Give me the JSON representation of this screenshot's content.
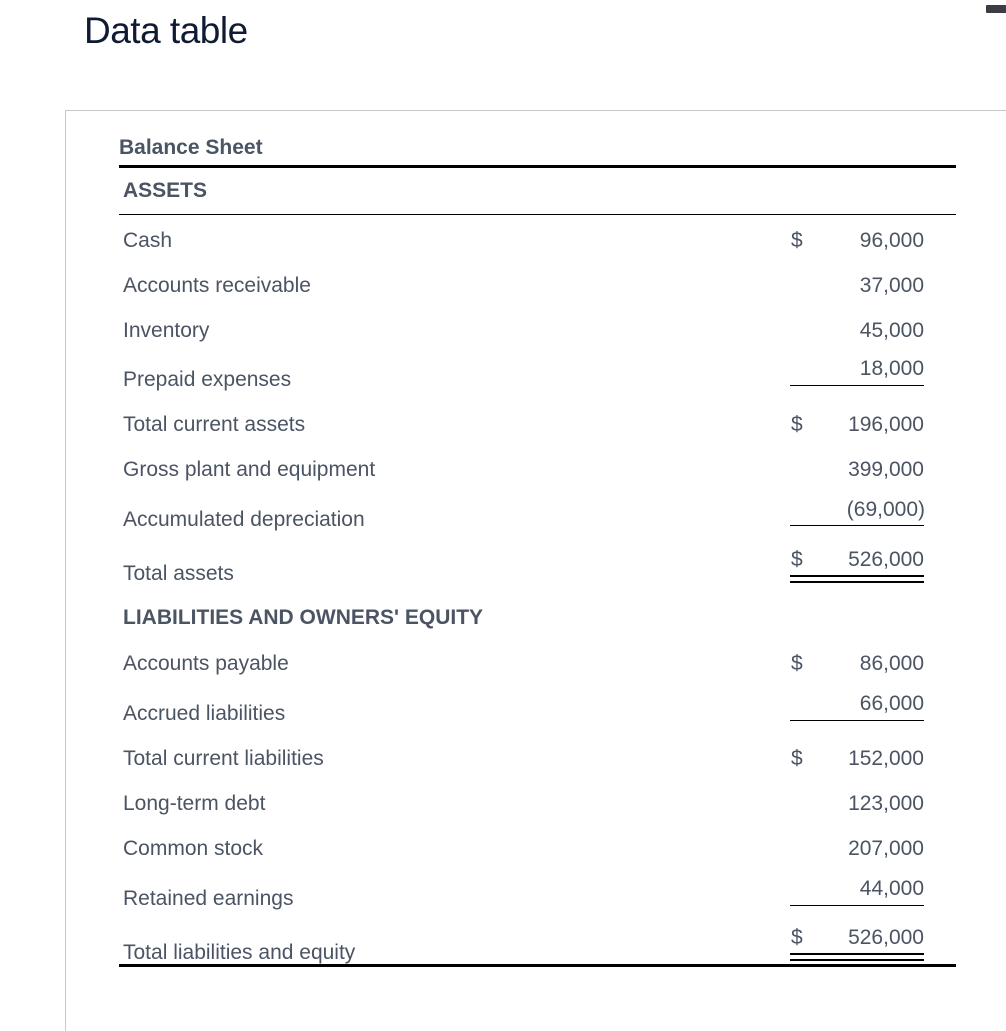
{
  "page_title": "Data table",
  "sheet": {
    "title": "Balance Sheet",
    "assets_heading": "ASSETS",
    "liabilities_heading": "LIABILITIES AND OWNERS' EQUITY",
    "currency_symbol": "$",
    "assets": [
      {
        "label": "Cash",
        "amount": "96,000",
        "dollar": "$"
      },
      {
        "label": "Accounts receivable",
        "amount": "37,000",
        "dollar": ""
      },
      {
        "label": "Inventory",
        "amount": "45,000",
        "dollar": ""
      },
      {
        "label": "Prepaid expenses",
        "amount": "18,000",
        "dollar": ""
      },
      {
        "label": "Total current assets",
        "amount": "196,000",
        "dollar": "$"
      },
      {
        "label": "Gross plant and equipment",
        "amount": "399,000",
        "dollar": ""
      },
      {
        "label": "Accumulated depreciation",
        "amount": "(69,000)",
        "dollar": ""
      },
      {
        "label": "Total assets",
        "amount": "526,000",
        "dollar": "$"
      }
    ],
    "liabilities": [
      {
        "label": "Accounts payable",
        "amount": "86,000",
        "dollar": "$"
      },
      {
        "label": "Accrued liabilities",
        "amount": "66,000",
        "dollar": ""
      },
      {
        "label": "Total current liabilities",
        "amount": "152,000",
        "dollar": "$"
      },
      {
        "label": "Long-term debt",
        "amount": "123,000",
        "dollar": ""
      },
      {
        "label": "Common stock",
        "amount": "207,000",
        "dollar": ""
      },
      {
        "label": "Retained earnings",
        "amount": "44,000",
        "dollar": ""
      },
      {
        "label": "Total liabilities and equity",
        "amount": "526,000",
        "dollar": "$"
      }
    ]
  }
}
